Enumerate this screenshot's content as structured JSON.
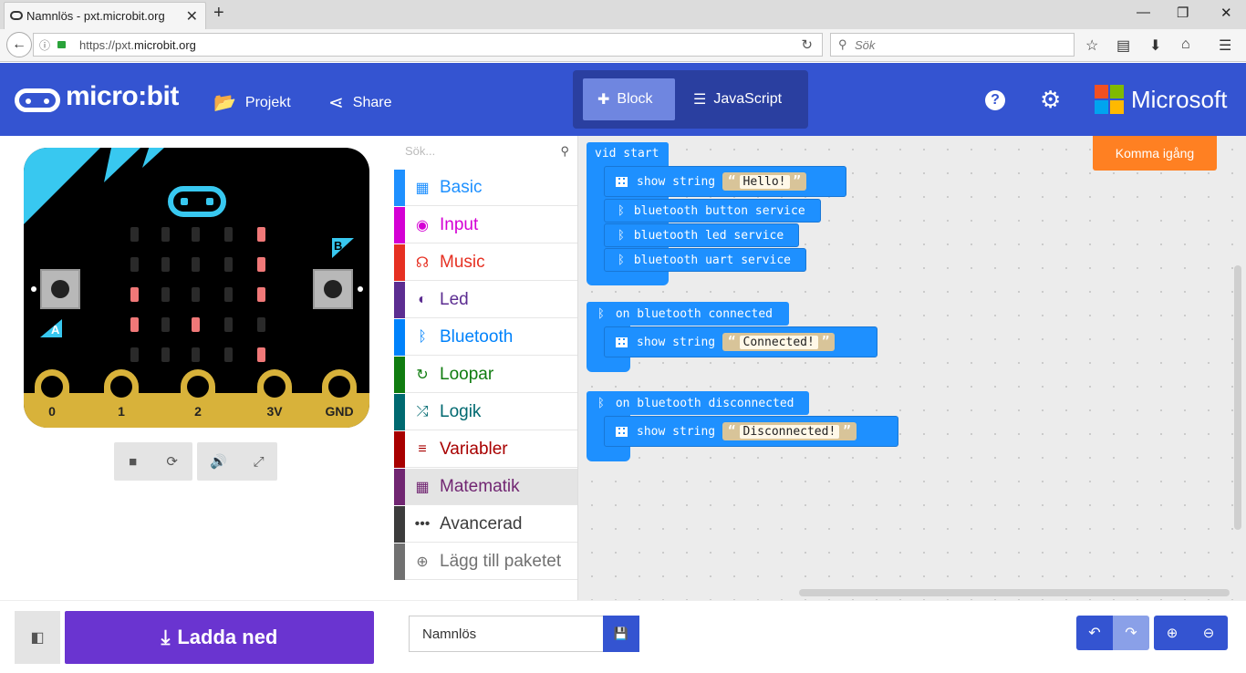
{
  "browser": {
    "tab_title": "Namnlös - pxt.microbit.org",
    "new_tab": "+",
    "url_prefix": "https://pxt.",
    "url_domain": "microbit.org",
    "search_placeholder": "Sök"
  },
  "header": {
    "logo_text": "micro:bit",
    "projects_label": "Projekt",
    "share_label": "Share",
    "block_label": "Block",
    "javascript_label": "JavaScript",
    "help_label": "?",
    "microsoft_label": "Microsoft"
  },
  "simulator": {
    "led_matrix": [
      [
        0,
        0,
        0,
        0,
        1
      ],
      [
        0,
        0,
        0,
        0,
        1
      ],
      [
        1,
        0,
        0,
        0,
        1
      ],
      [
        1,
        0,
        1,
        0,
        0
      ],
      [
        0,
        0,
        0,
        0,
        1
      ]
    ],
    "button_a": "A",
    "button_b": "B",
    "pins": [
      "0",
      "1",
      "2",
      "3V",
      "GND"
    ]
  },
  "toolbox": {
    "search_placeholder": "Sök...",
    "categories": [
      {
        "label": "Basic",
        "color": "#1e90ff",
        "icon": "grid-icon"
      },
      {
        "label": "Input",
        "color": "#d400d4",
        "icon": "target-icon"
      },
      {
        "label": "Music",
        "color": "#e63022",
        "icon": "headphones-icon"
      },
      {
        "label": "Led",
        "color": "#5c2d91",
        "icon": "toggle-icon"
      },
      {
        "label": "Bluetooth",
        "color": "#0082fb",
        "icon": "bluetooth-icon"
      },
      {
        "label": "Loopar",
        "color": "#107c10",
        "icon": "refresh-icon"
      },
      {
        "label": "Logik",
        "color": "#006970",
        "icon": "shuffle-icon"
      },
      {
        "label": "Variabler",
        "color": "#a80000",
        "icon": "lines-icon"
      },
      {
        "label": "Matematik",
        "color": "#712672",
        "icon": "calculator-icon"
      },
      {
        "label": "Avancerad",
        "color": "#3c3c3c",
        "icon": "ellipsis-icon"
      },
      {
        "label": "Lägg till paketet",
        "color": "#717171",
        "icon": "plus-circle-icon"
      }
    ]
  },
  "workspace": {
    "start_label": "vid start",
    "show_string": "show string",
    "hello_text": "Hello!",
    "bt_button": "bluetooth button service",
    "bt_led": "bluetooth led service",
    "bt_uart": "bluetooth uart service",
    "on_connected": "on bluetooth connected",
    "connected_text": "Connected!",
    "on_disconnected": "on bluetooth disconnected",
    "disconnected_text": "Disconnected!",
    "get_started": "Komma igång"
  },
  "bottom": {
    "download_label": "Ladda ned",
    "project_name": "Namnlös"
  }
}
